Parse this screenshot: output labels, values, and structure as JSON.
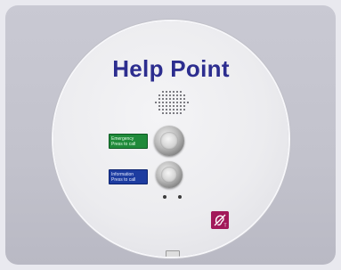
{
  "panel": {
    "title": "Help Point",
    "emergency_label": [
      "Emergency",
      "Press to call"
    ],
    "information_label": [
      "Information",
      "Press to call"
    ]
  },
  "colors": {
    "title": "#2c2d8f",
    "emergency": "#1f8a3a",
    "information": "#1d3ca0",
    "loop_sign": "#a2195a"
  },
  "icons": {
    "speaker": "speaker-grille-icon",
    "loop": "hearing-loop-icon"
  }
}
